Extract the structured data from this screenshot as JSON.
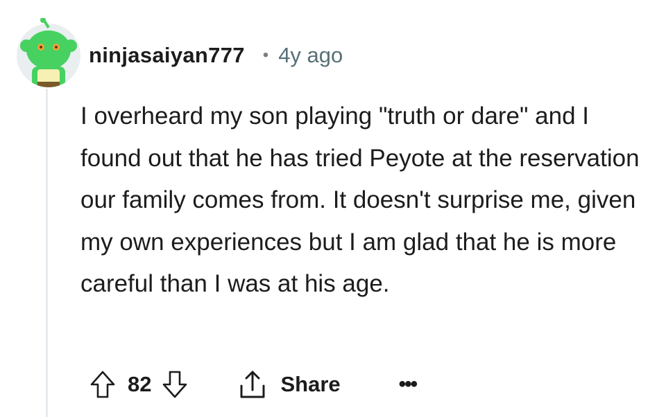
{
  "comment": {
    "author": "ninjasaiyan777",
    "separator": "•",
    "age": "4y ago",
    "body": "I overheard my son playing \"truth or dare\" and I found out that he has tried Peyote at the reservation our family comes from. It doesn't surprise me, given my own experiences but I am glad that he is more careful than I was at his age.",
    "votes": "82",
    "share_label": "Share",
    "more_label": "•••"
  },
  "icons": {
    "avatar": "snoo-avatar-icon",
    "upvote": "upvote-arrow-icon",
    "downvote": "downvote-arrow-icon",
    "share": "share-icon",
    "more": "overflow-menu-icon"
  },
  "colors": {
    "avatar_green": "#46d160",
    "meta_gray": "#576f76",
    "thread_line": "#e5ebee",
    "text": "#1c1c1c"
  }
}
